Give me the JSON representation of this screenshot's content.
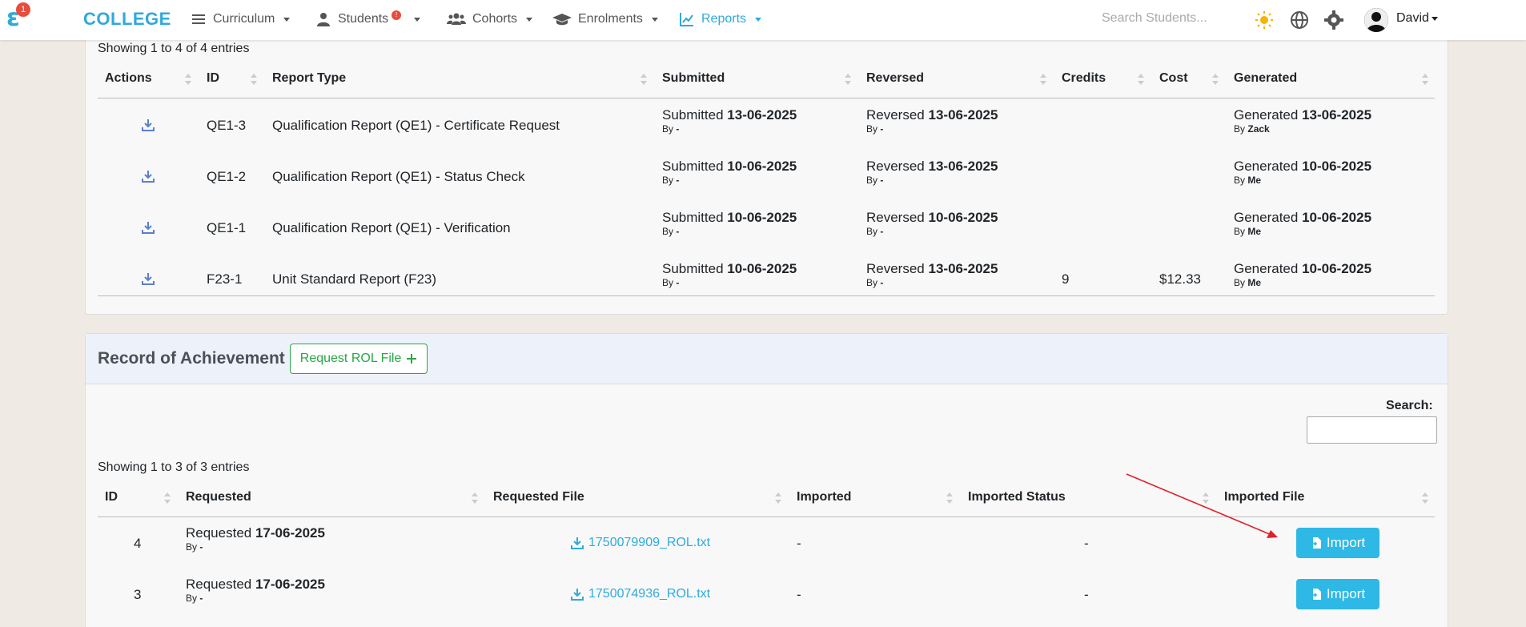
{
  "nav": {
    "logo_badge": "1",
    "brand": "COLLEGE",
    "items": [
      {
        "label": "Curriculum"
      },
      {
        "label": "Students",
        "alert": "!"
      },
      {
        "label": "Cohorts"
      },
      {
        "label": "Enrolments"
      },
      {
        "label": "Reports"
      }
    ],
    "search_placeholder": "Search Students...",
    "user": "David"
  },
  "reports": {
    "showing": "Showing 1 to 4 of 4 entries",
    "columns": [
      "Actions",
      "ID",
      "Report Type",
      "Submitted",
      "Reversed",
      "Credits",
      "Cost",
      "Generated"
    ],
    "rows": [
      {
        "id": "QE1-3",
        "type": "Qualification Report (QE1) - Certificate Request",
        "submitted_label": "Submitted",
        "submitted": "13-06-2025",
        "submitted_by": "-",
        "reversed_label": "Reversed",
        "reversed": "13-06-2025",
        "reversed_by": "-",
        "credits": "",
        "cost": "",
        "generated_label": "Generated",
        "generated": "13-06-2025",
        "generated_by": "Zack"
      },
      {
        "id": "QE1-2",
        "type": "Qualification Report (QE1) - Status Check",
        "submitted_label": "Submitted",
        "submitted": "10-06-2025",
        "submitted_by": "-",
        "reversed_label": "Reversed",
        "reversed": "13-06-2025",
        "reversed_by": "-",
        "credits": "",
        "cost": "",
        "generated_label": "Generated",
        "generated": "10-06-2025",
        "generated_by": "Me"
      },
      {
        "id": "QE1-1",
        "type": "Qualification Report (QE1) - Verification",
        "submitted_label": "Submitted",
        "submitted": "10-06-2025",
        "submitted_by": "-",
        "reversed_label": "Reversed",
        "reversed": "10-06-2025",
        "reversed_by": "-",
        "credits": "",
        "cost": "",
        "generated_label": "Generated",
        "generated": "10-06-2025",
        "generated_by": "Me"
      },
      {
        "id": "F23-1",
        "type": "Unit Standard Report (F23)",
        "submitted_label": "Submitted",
        "submitted": "10-06-2025",
        "submitted_by": "-",
        "reversed_label": "Reversed",
        "reversed": "13-06-2025",
        "reversed_by": "-",
        "credits": "9",
        "cost": "$12.33",
        "generated_label": "Generated",
        "generated": "10-06-2025",
        "generated_by": "Me"
      }
    ],
    "by_label": "By"
  },
  "rol": {
    "title": "Record of Achievement",
    "request_button": "Request ROL File",
    "search_label": "Search:",
    "showing": "Showing 1 to 3 of 3 entries",
    "columns": [
      "ID",
      "Requested",
      "Requested File",
      "Imported",
      "Imported Status",
      "Imported File"
    ],
    "rows": [
      {
        "id": "4",
        "requested_label": "Requested",
        "requested": "17-06-2025",
        "requested_by": "-",
        "file": "1750079909_ROL.txt",
        "imported": "-",
        "status": "-",
        "action": "Import"
      },
      {
        "id": "3",
        "requested_label": "Requested",
        "requested": "17-06-2025",
        "requested_by": "-",
        "file": "1750074936_ROL.txt",
        "imported": "-",
        "status": "-",
        "action": "Import"
      }
    ]
  },
  "colors": {
    "accent": "#2eaadc",
    "success": "#28a745",
    "danger": "#e74c3c",
    "annotation": "#e0202a"
  }
}
